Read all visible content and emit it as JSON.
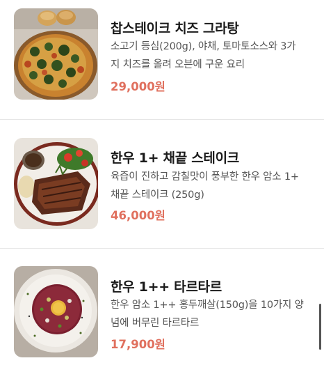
{
  "menu": {
    "items": [
      {
        "name": "찹스테이크 치즈 그라탕",
        "description_lines": [
          "소고기 등심(200g), 야채, 토마토소스와 3가",
          "지 치즈를 올려 오븐에 구운 요리"
        ],
        "price": "29,000원",
        "image_icon": "cheese-gratin-photo"
      },
      {
        "name": "한우 1+ 채끝 스테이크",
        "description_lines": [
          "육즙이 진하고 감칠맛이 풍부한 한우 암소 1+",
          "채끝 스테이크 (250g)"
        ],
        "price": "46,000원",
        "image_icon": "sirloin-steak-photo"
      },
      {
        "name": "한우 1++ 타르타르",
        "description_lines": [
          "한우 암소 1++ 홍두깨살(150g)을 10가지 양",
          "념에 버무린 타르타르"
        ],
        "price": "17,900원",
        "image_icon": "beef-tartare-photo"
      }
    ]
  },
  "colors": {
    "price": "#e0705e",
    "name": "#1a1a1a",
    "description": "#555555",
    "divider": "#e6e6e6"
  }
}
